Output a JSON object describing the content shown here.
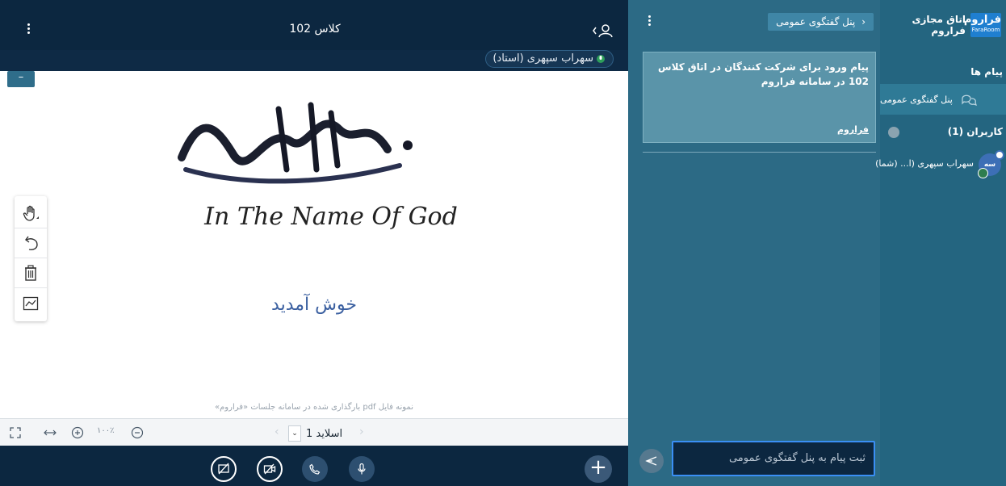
{
  "presentation": {
    "title": "کلاس 102",
    "presenter": "سهراب سپهری (استاد)",
    "minimize_label": "–",
    "slide": {
      "header_text": "In The Name Of God",
      "welcome": "خوش آمدید",
      "note": "نمونه فایل pdf بارگذاری شده در سامانه جلسات «فراروم»"
    },
    "tools": [
      "hand-icon",
      "undo-icon",
      "trash-icon",
      "chart-icon"
    ],
    "controls": {
      "zoom": "۱۰۰٪",
      "slide_label": "اسلاید 1",
      "prev": "‹",
      "next": "›"
    },
    "actions": [
      "screen-share-off-icon",
      "video-off-icon",
      "phone-icon",
      "microphone-icon"
    ],
    "plus_label": "+"
  },
  "chat": {
    "title": "پنل گفتگوی عمومی",
    "back_arrow": "‹",
    "welcome_message": "پیام ورود برای شرکت کنندگان در اتاق کلاس 102 در سامانه فراروم",
    "welcome_link": "فراروم",
    "input_placeholder": "ثبت پیام به پنل گفتگوی عمومی",
    "send_icon": "send-icon"
  },
  "sidebar": {
    "brand_name": "اتاق مجازی فراروم",
    "logo_fa": "فراروم",
    "logo_en": "FaraRoom",
    "messages_title": "پیام ها",
    "public_chat": "پنل گفتگوی عمومی",
    "users_title": "کاربران (1)",
    "user_name": "سهراب سپهری (ا... (شما)",
    "user_avatar": "سه"
  },
  "colors": {
    "dark_navy": "#0c2740",
    "chat_teal": "#2c6a85",
    "sidebar_teal": "#246580",
    "accent_blue": "#3a8ff5"
  }
}
